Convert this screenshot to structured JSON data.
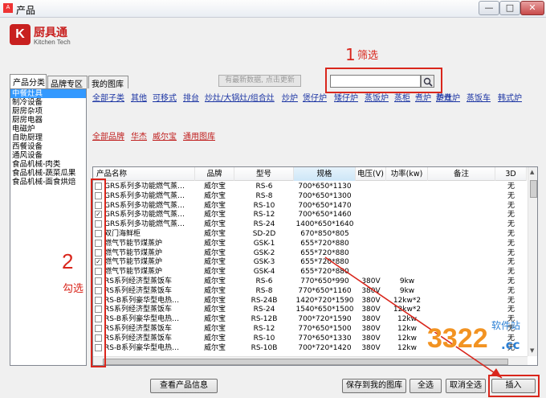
{
  "window": {
    "title": "产品",
    "app_icon": "A",
    "minimize": "—",
    "maximize": "□",
    "close": "✕"
  },
  "logo": {
    "mark": "K",
    "name_cn": "厨具通",
    "name_en": "Kitchen Tech"
  },
  "tabs": [
    {
      "label": "产品分类"
    },
    {
      "label": "品牌专区"
    },
    {
      "label": "我的图库"
    }
  ],
  "categories": [
    "中餐灶具",
    "制冷设备",
    "厨房杂项",
    "厨房电器",
    "电磁炉",
    "自助厨理",
    "西餐设备",
    "通风设备",
    "食品机械-肉类",
    "食品机械-蔬菜瓜果",
    "食品机械-面食烘焙"
  ],
  "refresh_label": "有最新数据, 点击更新",
  "search": {
    "value": "",
    "icon": "search-icon"
  },
  "annotations": {
    "step1_num": "1",
    "step1_label": "筛选",
    "step2_num": "2",
    "step2_label": "勾选"
  },
  "filters": {
    "types": [
      "全部子类",
      "其他",
      "可移式",
      "排台",
      "炒灶/大锅灶/组合灶",
      "炒炉",
      "煲仔炉",
      "矮仔炉",
      "蒸饭炉",
      "蒸柜",
      "煮炉",
      "炉灶",
      "蒸煮炉",
      "蒸饭车",
      "韩式炉"
    ],
    "brands": [
      "全部品牌",
      "华杰",
      "威尔宝",
      "通用图库"
    ]
  },
  "table": {
    "columns": [
      "产品名称",
      "品牌",
      "型号",
      "规格",
      "电压(V)",
      "功率(kw)",
      "备注",
      "3D"
    ],
    "rows": [
      {
        "checked": false,
        "name": "GRS系列多功能燃气蒸…",
        "brand": "威尔宝",
        "model": "RS-6",
        "spec": "700*650*1130",
        "voltage": "",
        "power": "",
        "remark": "",
        "d3": "无"
      },
      {
        "checked": false,
        "name": "GRS系列多功能燃气蒸…",
        "brand": "威尔宝",
        "model": "RS-8",
        "spec": "700*650*1300",
        "voltage": "",
        "power": "",
        "remark": "",
        "d3": "无"
      },
      {
        "checked": false,
        "name": "GRS系列多功能燃气蒸…",
        "brand": "威尔宝",
        "model": "RS-10",
        "spec": "700*650*1470",
        "voltage": "",
        "power": "",
        "remark": "",
        "d3": "无"
      },
      {
        "checked": true,
        "name": "GRS系列多功能燃气蒸…",
        "brand": "威尔宝",
        "model": "RS-12",
        "spec": "700*650*1460",
        "voltage": "",
        "power": "",
        "remark": "",
        "d3": "无"
      },
      {
        "checked": false,
        "name": "GRS系列多功能燃气蒸…",
        "brand": "威尔宝",
        "model": "RS-24",
        "spec": "1400*650*1640",
        "voltage": "",
        "power": "",
        "remark": "",
        "d3": "无"
      },
      {
        "checked": false,
        "name": "双门海鲜柜",
        "brand": "威尔宝",
        "model": "SD-2D",
        "spec": "670*850*805",
        "voltage": "",
        "power": "",
        "remark": "",
        "d3": "无"
      },
      {
        "checked": false,
        "name": "燃气节能节煤蒸炉",
        "brand": "威尔宝",
        "model": "GSK-1",
        "spec": "655*720*880",
        "voltage": "",
        "power": "",
        "remark": "",
        "d3": "无"
      },
      {
        "checked": false,
        "name": "燃气节能节煤蒸炉",
        "brand": "威尔宝",
        "model": "GSK-2",
        "spec": "655*720*880",
        "voltage": "",
        "power": "",
        "remark": "",
        "d3": "无"
      },
      {
        "checked": true,
        "name": "燃气节能节煤蒸炉",
        "brand": "威尔宝",
        "model": "GSK-3",
        "spec": "655*720*880",
        "voltage": "",
        "power": "",
        "remark": "",
        "d3": "无"
      },
      {
        "checked": false,
        "name": "燃气节能节煤蒸炉",
        "brand": "威尔宝",
        "model": "GSK-4",
        "spec": "655*720*880",
        "voltage": "",
        "power": "",
        "remark": "",
        "d3": "无"
      },
      {
        "checked": false,
        "name": "RS系列经济型蒸饭车",
        "brand": "威尔宝",
        "model": "RS-6",
        "spec": "770*650*990",
        "voltage": "380V",
        "power": "9kw",
        "remark": "",
        "d3": "无"
      },
      {
        "checked": false,
        "name": "RS系列经济型蒸饭车",
        "brand": "威尔宝",
        "model": "RS-8",
        "spec": "770*650*1160",
        "voltage": "380V",
        "power": "9kw",
        "remark": "",
        "d3": "无"
      },
      {
        "checked": false,
        "name": "RS-B系列豪华型电热…",
        "brand": "威尔宝",
        "model": "RS-24B",
        "spec": "1420*720*1590",
        "voltage": "380V",
        "power": "12kw*2",
        "remark": "",
        "d3": "无"
      },
      {
        "checked": false,
        "name": "RS系列经济型蒸饭车",
        "brand": "威尔宝",
        "model": "RS-24",
        "spec": "1540*650*1500",
        "voltage": "380V",
        "power": "12kw*2",
        "remark": "",
        "d3": "无"
      },
      {
        "checked": false,
        "name": "RS-B系列豪华型电热…",
        "brand": "威尔宝",
        "model": "RS-12B",
        "spec": "700*720*1590",
        "voltage": "380V",
        "power": "12kw",
        "remark": "",
        "d3": "无"
      },
      {
        "checked": false,
        "name": "RS系列经济型蒸饭车",
        "brand": "威尔宝",
        "model": "RS-12",
        "spec": "770*650*1500",
        "voltage": "380V",
        "power": "12kw",
        "remark": "",
        "d3": "无"
      },
      {
        "checked": false,
        "name": "RS系列经济型蒸饭车",
        "brand": "威尔宝",
        "model": "RS-10",
        "spec": "770*650*1330",
        "voltage": "380V",
        "power": "12kw",
        "remark": "",
        "d3": "无"
      },
      {
        "checked": false,
        "name": "RS-B系列豪华型电热…",
        "brand": "威尔宝",
        "model": "RS-10B",
        "spec": "700*720*1420",
        "voltage": "380V",
        "power": "12kw",
        "remark": "",
        "d3": "无"
      }
    ]
  },
  "buttons": {
    "view_info": "查看产品信息",
    "save_gallery": "保存到我的图库",
    "select_all": "全选",
    "deselect_all": "取消全选",
    "insert": "插入"
  },
  "watermark": {
    "big": "3322",
    "small": "软件站",
    "cc": ".cc"
  },
  "colors": {
    "annotation_red": "#d9261c",
    "link_blue": "#1b34a3",
    "brand_red": "#c0201f",
    "selected_blue": "#3399ff"
  }
}
